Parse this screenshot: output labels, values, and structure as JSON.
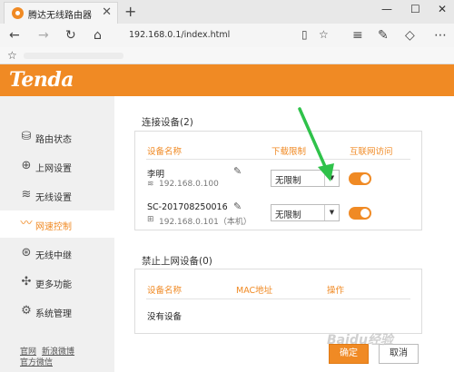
{
  "browser": {
    "tab_title": "腾达无线路由器",
    "tab_close": "✕",
    "new_tab": "+",
    "url": "192.168.0.1/index.html",
    "window_controls": [
      "—",
      "☐",
      "✕"
    ]
  },
  "brand": {
    "logo": "Tenda",
    "accent": "#f08a24"
  },
  "sidebar": {
    "items": [
      {
        "label": "路由状态",
        "icon": "router-status-icon",
        "glyph": "⛁",
        "active": false
      },
      {
        "label": "上网设置",
        "icon": "globe-icon",
        "glyph": "⊕",
        "active": false
      },
      {
        "label": "无线设置",
        "icon": "wifi-icon",
        "glyph": "≋",
        "active": false
      },
      {
        "label": "网速控制",
        "icon": "speed-icon",
        "glyph": "〰",
        "active": true
      },
      {
        "label": "无线中继",
        "icon": "relay-icon",
        "glyph": "⊛",
        "active": false
      },
      {
        "label": "更多功能",
        "icon": "more-functions-icon",
        "glyph": "✣",
        "active": false
      },
      {
        "label": "系统管理",
        "icon": "gear-icon",
        "glyph": "⚙",
        "active": false
      }
    ],
    "footer_link_1": "官网",
    "footer_link_2": "新浪微博",
    "footer_link_3": "官方微信"
  },
  "connected": {
    "title": "连接设备(2)",
    "headers": {
      "name": "设备名称",
      "limit": "下载限制",
      "access": "互联网访问"
    },
    "devices": [
      {
        "name": "李明",
        "ip": "192.168.0.100",
        "limit": "无限制",
        "access": true
      },
      {
        "name": "SC-201708250016",
        "ip": "192.168.0.101（本机）",
        "limit": "无限制",
        "access": true
      }
    ]
  },
  "blocked": {
    "title": "禁止上网设备(0)",
    "headers": {
      "name": "设备名称",
      "mac": "MAC地址",
      "action": "操作"
    },
    "empty_text": "没有设备"
  },
  "buttons": {
    "ok": "确定",
    "cancel": "取消"
  },
  "watermark": "Baidu经验"
}
